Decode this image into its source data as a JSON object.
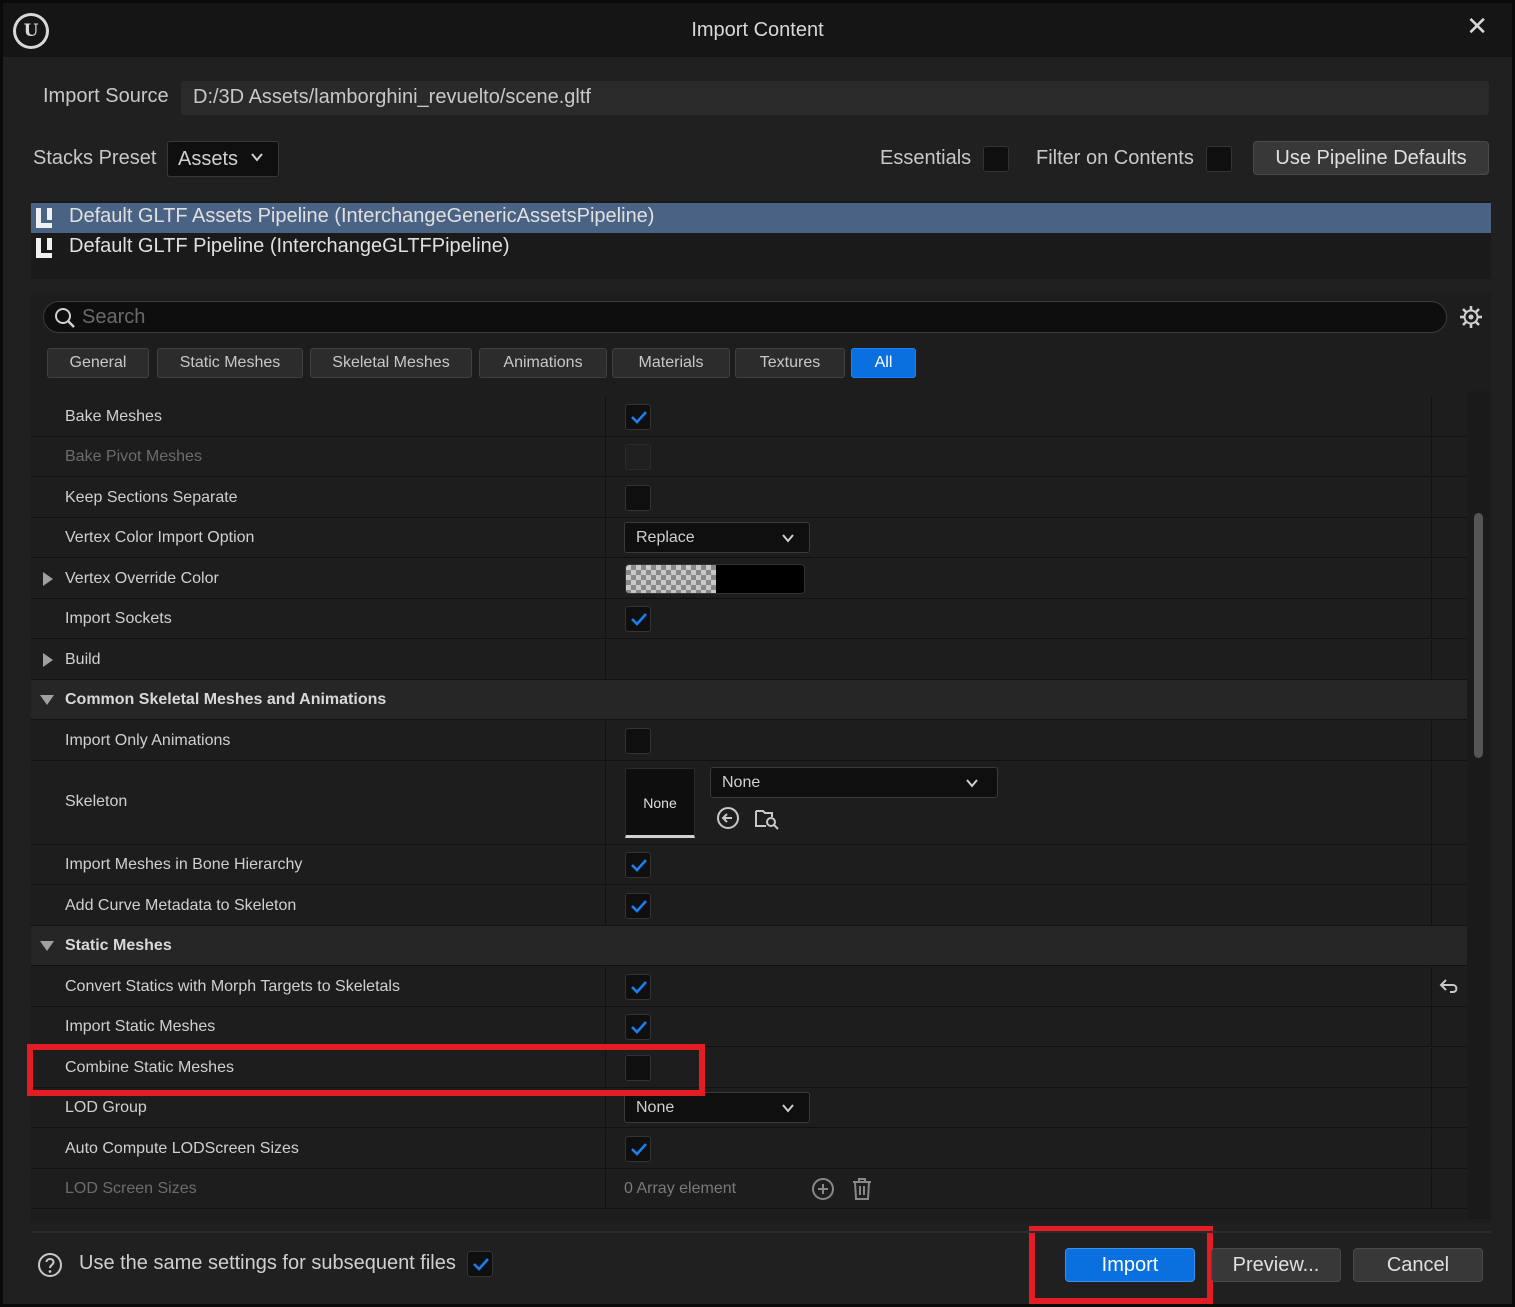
{
  "window": {
    "title": "Import Content"
  },
  "import_source": {
    "label": "Import Source",
    "value": "D:/3D Assets/lamborghini_revuelto/scene.gltf"
  },
  "stacks": {
    "label": "Stacks Preset",
    "preset": "Assets",
    "essentials_label": "Essentials",
    "essentials_checked": false,
    "filter_label": "Filter on Contents",
    "filter_checked": false,
    "defaults_button": "Use Pipeline Defaults"
  },
  "pipelines": [
    {
      "label": "Default GLTF Assets Pipeline (InterchangeGenericAssetsPipeline)",
      "selected": true
    },
    {
      "label": "Default GLTF Pipeline (InterchangeGLTFPipeline)",
      "selected": false
    }
  ],
  "search": {
    "placeholder": "Search"
  },
  "filter_tabs": [
    "General",
    "Static Meshes",
    "Skeletal Meshes",
    "Animations",
    "Materials",
    "Textures",
    "All"
  ],
  "active_tab": "All",
  "rows": {
    "bake_meshes": {
      "label": "Bake Meshes",
      "checked": true
    },
    "bake_pivot_meshes": {
      "label": "Bake Pivot Meshes",
      "checked": false,
      "disabled": true
    },
    "keep_sections_separate": {
      "label": "Keep Sections Separate",
      "checked": false
    },
    "vertex_color_import_option": {
      "label": "Vertex Color Import Option",
      "value": "Replace"
    },
    "vertex_override_color": {
      "label": "Vertex Override Color",
      "color": "#000000"
    },
    "import_sockets": {
      "label": "Import Sockets",
      "checked": true
    },
    "build": {
      "label": "Build"
    },
    "cat_common_skeletal": {
      "label": "Common Skeletal Meshes and Animations"
    },
    "import_only_animations": {
      "label": "Import Only Animations",
      "checked": false
    },
    "skeleton": {
      "label": "Skeleton",
      "thumb": "None",
      "value": "None"
    },
    "import_meshes_bone_hierarchy": {
      "label": "Import Meshes in Bone Hierarchy",
      "checked": true
    },
    "add_curve_metadata": {
      "label": "Add Curve Metadata to Skeleton",
      "checked": true
    },
    "cat_static_meshes": {
      "label": "Static Meshes"
    },
    "convert_statics_morph": {
      "label": "Convert Statics with Morph Targets to Skeletals",
      "checked": true
    },
    "import_static_meshes": {
      "label": "Import Static Meshes",
      "checked": true
    },
    "combine_static_meshes": {
      "label": "Combine Static Meshes",
      "checked": false
    },
    "lod_group": {
      "label": "LOD Group",
      "value": "None"
    },
    "auto_compute_lod": {
      "label": "Auto Compute LODScreen Sizes",
      "checked": true
    },
    "lod_screen_sizes": {
      "label": "LOD Screen Sizes",
      "value": "0 Array element"
    }
  },
  "footer": {
    "same_settings_label": "Use the same settings for subsequent files",
    "same_settings_checked": true,
    "import_button": "Import",
    "preview_button": "Preview...",
    "cancel_button": "Cancel"
  },
  "colors": {
    "accent": "#0a70e0",
    "selection": "#4a6384",
    "highlight": "#e41c23",
    "check": "#1a7ff0"
  }
}
